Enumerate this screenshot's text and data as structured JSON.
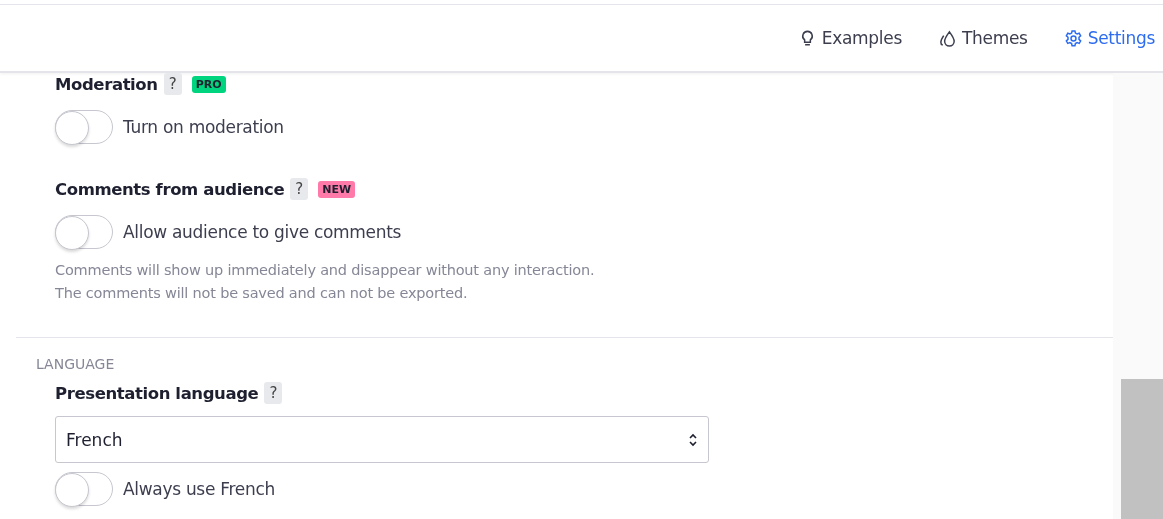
{
  "nav": [
    {
      "label": "Examples",
      "kind": "bulb",
      "selected": false
    },
    {
      "label": "Themes",
      "kind": "drops",
      "selected": false
    },
    {
      "label": "Settings",
      "kind": "gear",
      "selected": true
    }
  ],
  "settings": [
    {
      "title": "Moderation",
      "help": "?",
      "badge": {
        "text": "PRO",
        "color": "#00d47e"
      },
      "toggle": {
        "on": false,
        "label": "Turn on moderation"
      }
    },
    {
      "title": "Comments from audience",
      "help": "?",
      "badge": {
        "text": "NEW",
        "color": "#ff7aa8"
      },
      "toggle": {
        "on": false,
        "label": "Allow audience to give comments"
      },
      "description": [
        "Comments will show up immediately and disappear without any interaction.",
        "The comments will not be saved and can not be exported."
      ]
    }
  ],
  "language": {
    "heading": "LANGUAGE",
    "title": "Presentation language",
    "help": "?",
    "select": {
      "value": "French"
    },
    "toggle": {
      "on": false,
      "label": "Always use French"
    }
  }
}
